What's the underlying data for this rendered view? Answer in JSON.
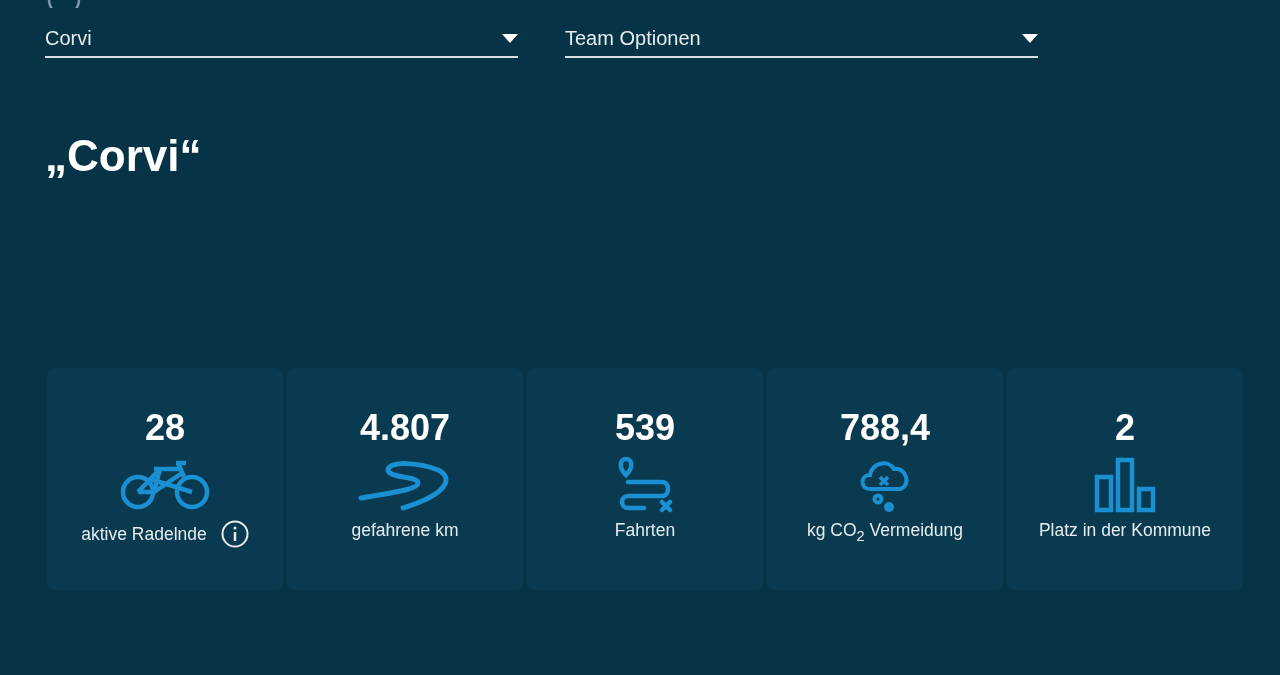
{
  "selects": [
    {
      "value": "Corvi"
    },
    {
      "value": "Team Optionen"
    }
  ],
  "title": "„Corvi“",
  "stats": [
    {
      "value": "28",
      "label": "aktive Radelnde",
      "kind": "riders",
      "info": true
    },
    {
      "value": "4.807",
      "label": "gefahrene km",
      "kind": "distance",
      "info": false
    },
    {
      "value": "539",
      "label": "Fahrten",
      "kind": "trips",
      "info": false
    },
    {
      "value": "788,4",
      "label": "kg CO$_{2}$ Vermeidung",
      "kind": "co2",
      "info": false
    },
    {
      "value": "2",
      "label": "Platz in der Kommune",
      "kind": "rank",
      "info": false
    }
  ]
}
